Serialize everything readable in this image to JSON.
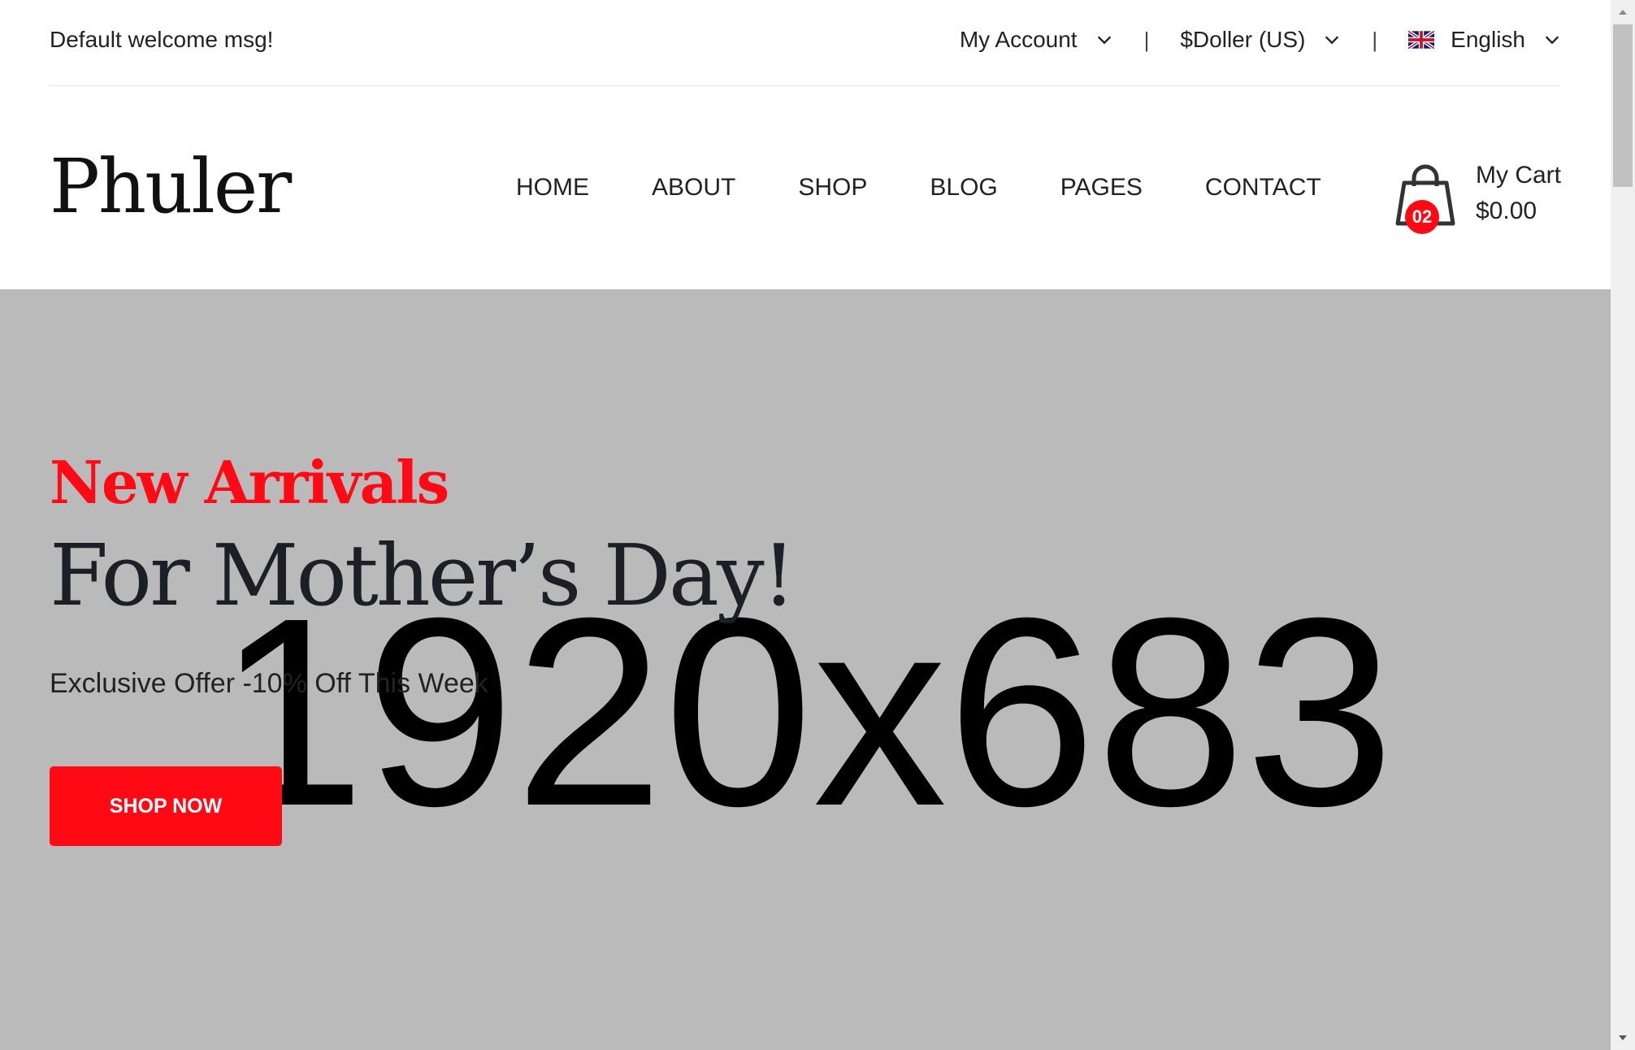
{
  "topbar": {
    "welcome": "Default welcome msg!",
    "account_label": "My Account",
    "currency_label": "$Doller (US)",
    "language_label": "English",
    "separator": "|"
  },
  "header": {
    "logo": "Phuler",
    "nav": [
      "HOME",
      "ABOUT",
      "SHOP",
      "BLOG",
      "PAGES",
      "CONTACT"
    ],
    "cart": {
      "count": "02",
      "label": "My Cart",
      "total": "$0.00"
    }
  },
  "hero": {
    "placeholder_text": "1920x683",
    "kicker": "New Arrivals",
    "title": "For Mother’s Day!",
    "subtitle": "Exclusive Offer -10% Off This Week",
    "button_label": "SHOP NOW"
  },
  "colors": {
    "accent": "#ff0a14",
    "hero_bg": "#bababa",
    "text": "#222222"
  },
  "icons": [
    "chevron-down-icon",
    "uk-flag-icon",
    "shopping-bag-icon",
    "scroll-up-arrow-icon",
    "scroll-down-arrow-icon"
  ]
}
